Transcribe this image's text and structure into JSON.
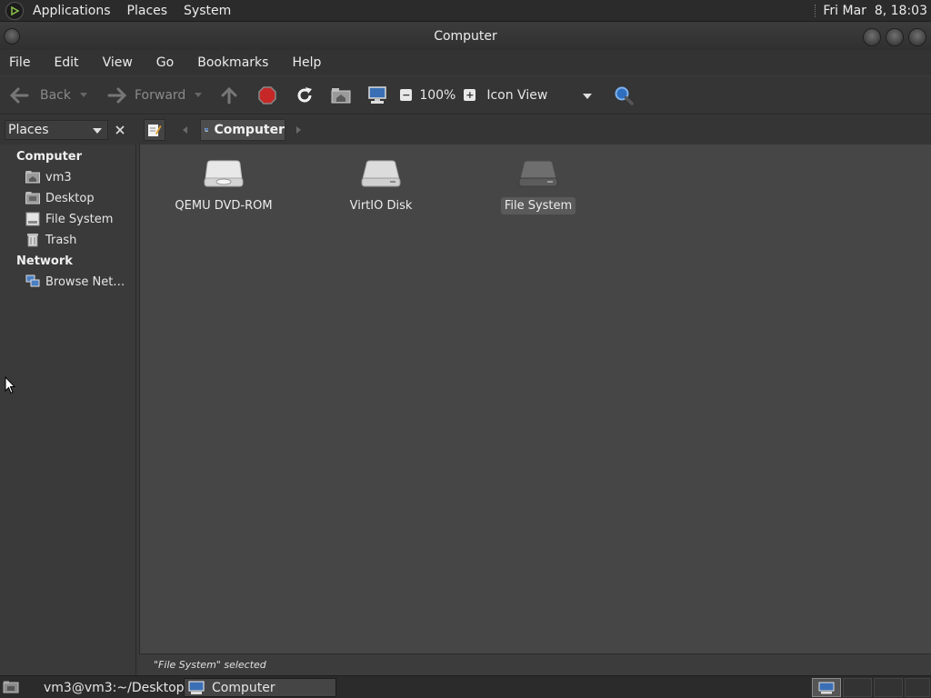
{
  "top_panel": {
    "menus": [
      "Applications",
      "Places",
      "System"
    ],
    "clock": "Fri Mar  8, 18:03"
  },
  "window": {
    "title": "Computer"
  },
  "menubar": {
    "items": [
      "File",
      "Edit",
      "View",
      "Go",
      "Bookmarks",
      "Help"
    ]
  },
  "toolbar": {
    "back_label": "Back",
    "forward_label": "Forward",
    "zoom_level": "100%",
    "zoom_out_symbol": "−",
    "zoom_in_symbol": "+",
    "view_mode": "Icon View"
  },
  "location": {
    "sidebar_selector": "Places",
    "breadcrumb": "Computer"
  },
  "sidebar": {
    "sections": [
      {
        "heading": "Computer",
        "items": [
          {
            "label": "vm3",
            "icon": "home-folder-icon"
          },
          {
            "label": "Desktop",
            "icon": "desktop-folder-icon"
          },
          {
            "label": "File System",
            "icon": "filesystem-icon"
          },
          {
            "label": "Trash",
            "icon": "trash-icon"
          }
        ]
      },
      {
        "heading": "Network",
        "items": [
          {
            "label": "Browse Net…",
            "icon": "network-icon"
          }
        ]
      }
    ]
  },
  "main": {
    "items": [
      {
        "label": "QEMU DVD-ROM",
        "icon": "optical-drive-icon",
        "selected": false
      },
      {
        "label": "VirtIO Disk",
        "icon": "hard-disk-icon",
        "selected": false
      },
      {
        "label": "File System",
        "icon": "filesystem-drive-icon",
        "selected": true
      }
    ]
  },
  "statusbar": {
    "text": "\"File System\" selected"
  },
  "taskbar": {
    "tasks": [
      {
        "label": "vm3@vm3:~/Desktop",
        "icon": "terminal-icon",
        "active": false
      },
      {
        "label": "Computer",
        "icon": "computer-icon",
        "active": true
      }
    ]
  },
  "colors": {
    "background": "#3a3a3a",
    "main_area": "#464646",
    "panel": "#2b2b2b",
    "text": "#e6e6e6",
    "stop_button": "#c62828",
    "search_accent": "#3a8ee6"
  }
}
